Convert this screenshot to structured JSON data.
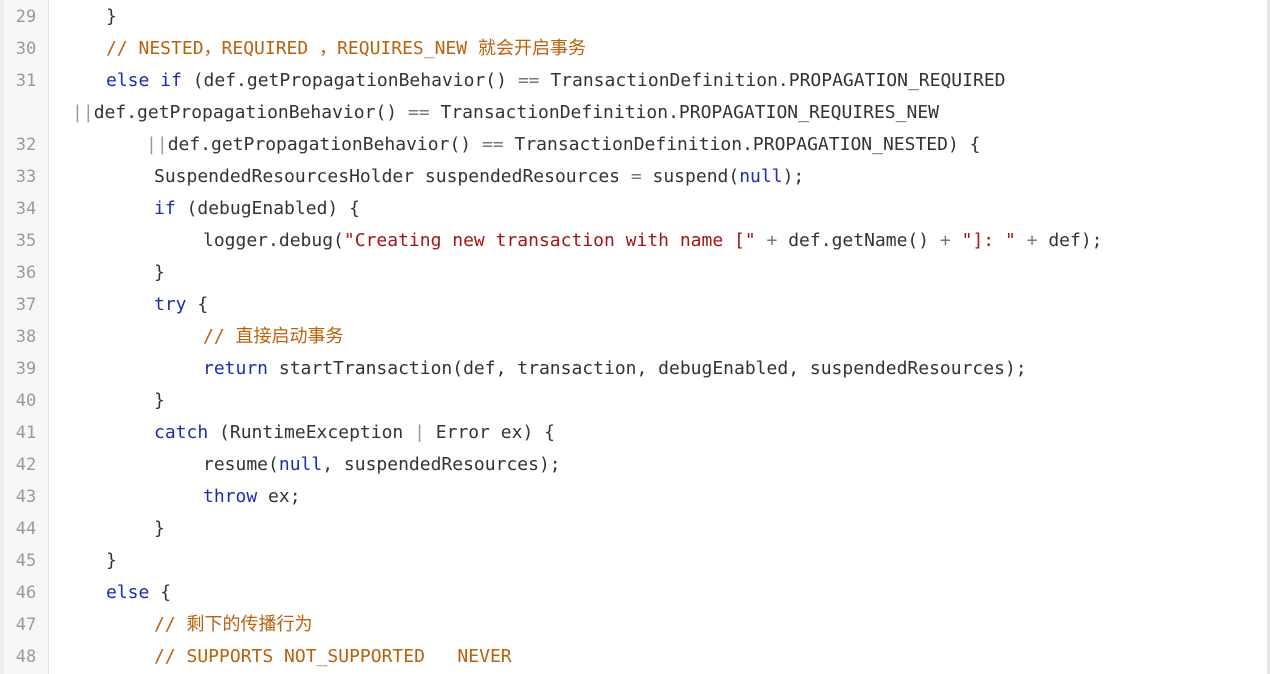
{
  "lines": [
    {
      "num": "29",
      "tokens": [
        {
          "t": "}",
          "c": ""
        }
      ]
    },
    {
      "num": "30",
      "tokens": [
        {
          "t": "// NESTED，REQUIRED ，REQUIRES_NEW 就会开启事务",
          "c": "cm"
        }
      ]
    },
    {
      "num": "31",
      "tokens": [
        {
          "t": "else if",
          "c": "kw"
        },
        {
          "t": " (def.getPropagationBehavior() ",
          "c": ""
        },
        {
          "t": "==",
          "c": "op"
        },
        {
          "t": " TransactionDefinition.PROPAGATION_REQUIRED",
          "c": ""
        }
      ]
    },
    {
      "num": "",
      "tokens": [
        {
          "t": "||",
          "c": "pipe"
        },
        {
          "t": "def.getPropagationBehavior() ",
          "c": ""
        },
        {
          "t": "==",
          "c": "op"
        },
        {
          "t": " TransactionDefinition.PROPAGATION_REQUIRES_NEW",
          "c": ""
        }
      ]
    },
    {
      "num": "32",
      "tokens": [
        {
          "t": "||",
          "c": "pipe"
        },
        {
          "t": "def.getPropagationBehavior() ",
          "c": ""
        },
        {
          "t": "==",
          "c": "op"
        },
        {
          "t": " TransactionDefinition.PROPAGATION_NESTED) {",
          "c": ""
        }
      ]
    },
    {
      "num": "33",
      "tokens": [
        {
          "t": "SuspendedResourcesHolder suspendedResources ",
          "c": ""
        },
        {
          "t": "=",
          "c": "op"
        },
        {
          "t": " suspend(",
          "c": ""
        },
        {
          "t": "null",
          "c": "lit"
        },
        {
          "t": ");",
          "c": ""
        }
      ]
    },
    {
      "num": "34",
      "tokens": [
        {
          "t": "if",
          "c": "kw"
        },
        {
          "t": " (debugEnabled) {",
          "c": ""
        }
      ]
    },
    {
      "num": "35",
      "tokens": [
        {
          "t": "logger.debug(",
          "c": ""
        },
        {
          "t": "\"Creating new transaction with name [\"",
          "c": "str"
        },
        {
          "t": " + ",
          "c": "op"
        },
        {
          "t": "def.getName()",
          "c": ""
        },
        {
          "t": " + ",
          "c": "op"
        },
        {
          "t": "\"]: \"",
          "c": "str"
        },
        {
          "t": " + ",
          "c": "op"
        },
        {
          "t": "def);",
          "c": ""
        }
      ]
    },
    {
      "num": "36",
      "tokens": [
        {
          "t": "}",
          "c": ""
        }
      ]
    },
    {
      "num": "37",
      "tokens": [
        {
          "t": "try",
          "c": "kw"
        },
        {
          "t": " {",
          "c": ""
        }
      ]
    },
    {
      "num": "38",
      "tokens": [
        {
          "t": "// 直接启动事务",
          "c": "cm"
        }
      ]
    },
    {
      "num": "39",
      "tokens": [
        {
          "t": "return",
          "c": "kw"
        },
        {
          "t": " startTransaction(def, transaction, debugEnabled, suspendedResources);",
          "c": ""
        }
      ]
    },
    {
      "num": "40",
      "tokens": [
        {
          "t": "}",
          "c": ""
        }
      ]
    },
    {
      "num": "41",
      "tokens": [
        {
          "t": "catch",
          "c": "kw"
        },
        {
          "t": " (RuntimeException ",
          "c": ""
        },
        {
          "t": "|",
          "c": "pipe"
        },
        {
          "t": " Error ex) {",
          "c": ""
        }
      ]
    },
    {
      "num": "42",
      "tokens": [
        {
          "t": "resume(",
          "c": ""
        },
        {
          "t": "null",
          "c": "lit"
        },
        {
          "t": ", suspendedResources);",
          "c": ""
        }
      ]
    },
    {
      "num": "43",
      "tokens": [
        {
          "t": "throw",
          "c": "kw"
        },
        {
          "t": " ex;",
          "c": ""
        }
      ]
    },
    {
      "num": "44",
      "tokens": [
        {
          "t": "}",
          "c": ""
        }
      ]
    },
    {
      "num": "45",
      "tokens": [
        {
          "t": "}",
          "c": ""
        }
      ]
    },
    {
      "num": "46",
      "tokens": [
        {
          "t": "else",
          "c": "kw"
        },
        {
          "t": " {",
          "c": ""
        }
      ]
    },
    {
      "num": "47",
      "tokens": [
        {
          "t": "// 剩下的传播行为",
          "c": "cm"
        }
      ]
    },
    {
      "num": "48",
      "tokens": [
        {
          "t": "// SUPPORTS NOT_SUPPORTED   NEVER",
          "c": "cm"
        }
      ]
    }
  ],
  "colors": {
    "keyword": "#1c2dad",
    "comment": "#b8620d",
    "string": "#a31515",
    "text": "#333333",
    "line_number": "#999999"
  }
}
